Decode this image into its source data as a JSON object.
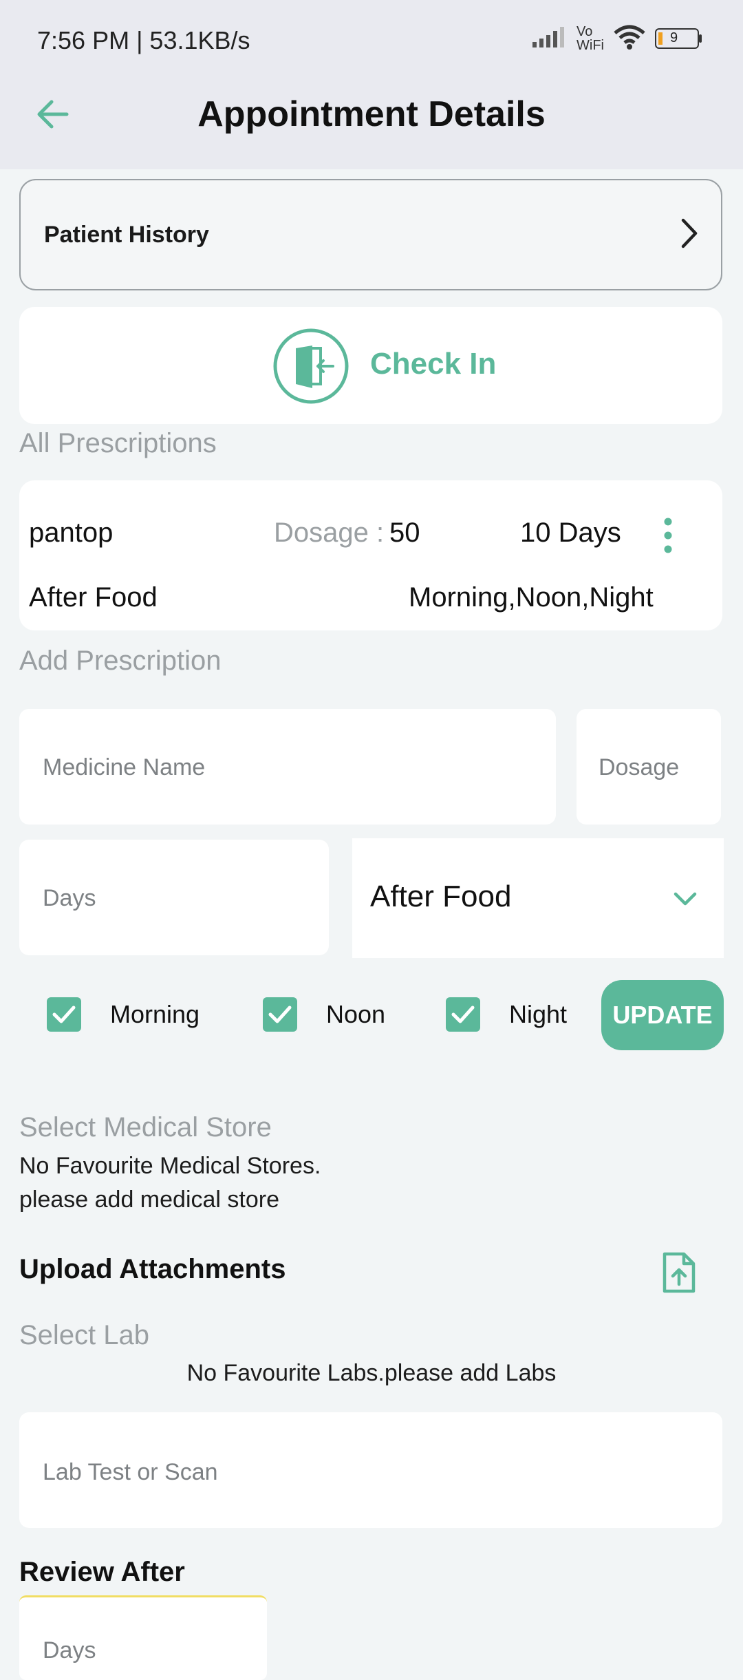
{
  "status_bar": {
    "time": "7:56 PM | 53.1KB/s",
    "battery": "9",
    "network_label_top": "Vo",
    "network_label_bottom": "WiFi"
  },
  "header": {
    "title": "Appointment Details",
    "back_icon": "arrow-left-icon"
  },
  "patient_history": {
    "label": "Patient History"
  },
  "check_in": {
    "label": "Check In"
  },
  "all_prescriptions": {
    "label": "All Prescriptions",
    "items": [
      {
        "name": "pantop",
        "dosage_label": "Dosage :",
        "dosage_value": "50",
        "days": "10 Days",
        "food": "After Food",
        "times": "Morning,Noon,Night"
      }
    ]
  },
  "add_prescription": {
    "label": "Add Prescription",
    "medicine_placeholder": "Medicine Name",
    "dosage_placeholder": "Dosage",
    "days_placeholder": "Days",
    "food_selected": "After Food",
    "checks": [
      {
        "label": "Morning",
        "checked": true
      },
      {
        "label": "Noon",
        "checked": true
      },
      {
        "label": "Night",
        "checked": true
      }
    ],
    "update_label": "UPDATE"
  },
  "medical_store": {
    "label": "Select Medical Store",
    "empty_line1": "No Favourite Medical Stores.",
    "empty_line2": "please add medical store"
  },
  "attachments": {
    "label": "Upload Attachments"
  },
  "lab": {
    "label": "Select Lab",
    "empty": "No Favourite Labs.please add Labs",
    "test_placeholder": "Lab Test or Scan"
  },
  "review": {
    "label": "Review After",
    "days_placeholder": "Days"
  },
  "colors": {
    "accent": "#5bb89a",
    "background": "#f2f5f6",
    "appbar": "#e9eaf0"
  }
}
